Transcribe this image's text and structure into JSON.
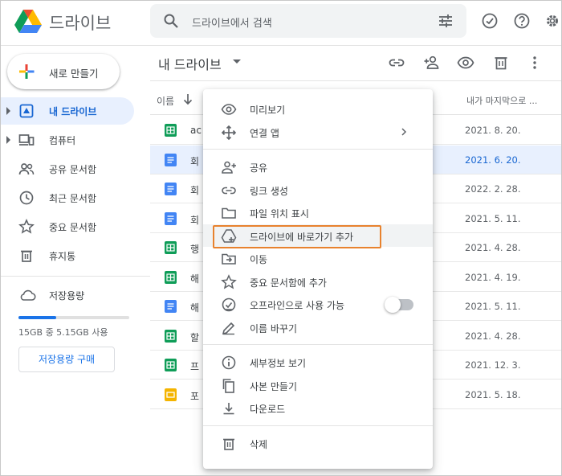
{
  "app": {
    "title": "드라이브"
  },
  "search": {
    "placeholder": "드라이브에서 검색"
  },
  "sidebar": {
    "new_label": "새로 만들기",
    "items": [
      {
        "label": "내 드라이브",
        "icon": "my-drive-icon"
      },
      {
        "label": "컴퓨터",
        "icon": "computer-icon"
      },
      {
        "label": "공유 문서함",
        "icon": "shared-icon"
      },
      {
        "label": "최근 문서함",
        "icon": "clock-icon"
      },
      {
        "label": "중요 문서함",
        "icon": "star-icon"
      },
      {
        "label": "휴지통",
        "icon": "trash-icon"
      }
    ],
    "storage_label": "저장용량",
    "storage_usage": "15GB 중 5.15GB 사용",
    "storage_fraction": 0.34,
    "buy_label": "저장용량 구매"
  },
  "main": {
    "title": "내 드라이브",
    "col_name": "이름",
    "col_date": "내가 마지막으로 ...",
    "rows": [
      {
        "name": "ac",
        "type": "sheets",
        "date": "2021. 8. 20."
      },
      {
        "name": "회",
        "type": "docs",
        "date": "2021. 6. 20."
      },
      {
        "name": "회",
        "type": "docs",
        "date": "2022. 2. 28."
      },
      {
        "name": "회",
        "type": "docs",
        "date": "2021. 5. 11."
      },
      {
        "name": "행",
        "type": "sheets",
        "date": "2021. 4. 28."
      },
      {
        "name": "해",
        "type": "sheets",
        "date": "2021. 4. 19."
      },
      {
        "name": "해",
        "type": "docs",
        "date": "2021. 5. 11."
      },
      {
        "name": "할",
        "type": "sheets",
        "date": "2021. 4. 28."
      },
      {
        "name": "프",
        "type": "sheets",
        "date": "2021. 12. 3."
      },
      {
        "name": "포",
        "type": "slides",
        "date": "2021. 5. 18."
      }
    ]
  },
  "menu": {
    "group1": [
      {
        "label": "미리보기",
        "icon": "eye-icon"
      },
      {
        "label": "연결 앱",
        "icon": "move-arrows-icon",
        "submenu": true
      }
    ],
    "group2": [
      {
        "label": "공유",
        "icon": "person-add-icon"
      },
      {
        "label": "링크 생성",
        "icon": "link-icon"
      },
      {
        "label": "파일 위치 표시",
        "icon": "folder-icon"
      },
      {
        "label": "드라이브에 바로가기 추가",
        "icon": "add-shortcut-icon"
      },
      {
        "label": "이동",
        "icon": "move-to-icon"
      },
      {
        "label": "중요 문서함에 추가",
        "icon": "star-icon"
      },
      {
        "label": "오프라인으로 사용 가능",
        "icon": "offline-icon",
        "toggle": false
      },
      {
        "label": "이름 바꾸기",
        "icon": "pencil-icon"
      }
    ],
    "group3": [
      {
        "label": "세부정보 보기",
        "icon": "info-icon"
      },
      {
        "label": "사본 만들기",
        "icon": "copy-icon"
      },
      {
        "label": "다운로드",
        "icon": "download-icon"
      }
    ],
    "group4": [
      {
        "label": "삭제",
        "icon": "trash-icon"
      }
    ]
  },
  "colors": {
    "accent": "#1a73e8",
    "highlight": "#e8822e",
    "sheets": "#0f9d58",
    "docs": "#4285f4",
    "slides": "#f4b400"
  }
}
